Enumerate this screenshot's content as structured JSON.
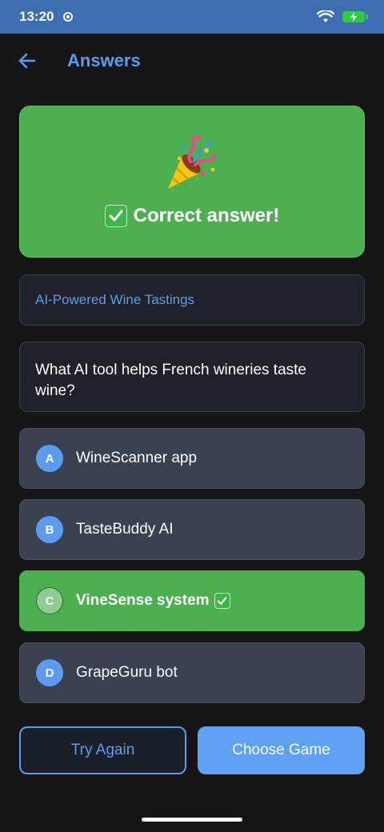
{
  "status_bar": {
    "time": "13:20"
  },
  "app_bar": {
    "title": "Answers"
  },
  "result": {
    "message": "Correct answer!"
  },
  "category": "AI-Powered Wine Tastings",
  "question": "What AI tool helps French wineries taste wine?",
  "options": [
    {
      "letter": "A",
      "text": "WineScanner app",
      "correct": false
    },
    {
      "letter": "B",
      "text": "TasteBuddy AI",
      "correct": false
    },
    {
      "letter": "C",
      "text": "VineSense system",
      "correct": true
    },
    {
      "letter": "D",
      "text": "GrapeGuru bot",
      "correct": false
    }
  ],
  "buttons": {
    "try_again": "Try Again",
    "choose_game": "Choose Game"
  },
  "colors": {
    "accent": "#5b9cf0",
    "success": "#4caf50",
    "status_bar": "#3d6fb0"
  },
  "icons": {
    "back": "arrow-left-icon",
    "celebration": "party-popper-icon",
    "check": "check-mark-icon"
  }
}
